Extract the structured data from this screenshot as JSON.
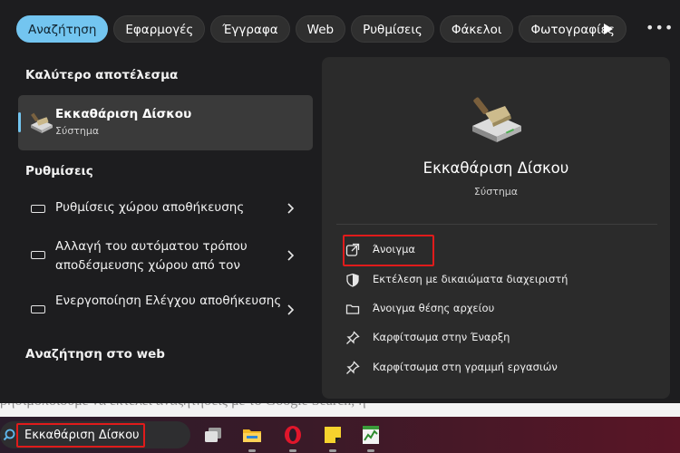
{
  "tabs": [
    {
      "label": "Αναζήτηση",
      "active": true
    },
    {
      "label": "Εφαρμογές",
      "active": false
    },
    {
      "label": "Έγγραφα",
      "active": false
    },
    {
      "label": "Web",
      "active": false
    },
    {
      "label": "Ρυθμίσεις",
      "active": false
    },
    {
      "label": "Φάκελοι",
      "active": false
    },
    {
      "label": "Φωτογραφίες",
      "active": false
    }
  ],
  "tab_more_icon": "more-icon",
  "left": {
    "best_match_title": "Καλύτερο αποτέλεσμα",
    "best_match": {
      "name": "Εκκαθάριση Δίσκου",
      "category": "Σύστημα",
      "icon": "disk-cleanup-icon"
    },
    "settings_title": "Ρυθμίσεις",
    "settings": [
      {
        "label": "Ρυθμίσεις χώρου αποθήκευσης",
        "icon": "storage-icon"
      },
      {
        "label": "Αλλαγή του αυτόματου τρόπου αποδέσμευσης χώρου από τον",
        "icon": "storage-icon"
      },
      {
        "label": "Ενεργοποίηση Ελέγχου αποθήκευσης",
        "icon": "storage-icon"
      }
    ],
    "web_title": "Αναζήτηση στο web"
  },
  "detail": {
    "name": "Εκκαθάριση Δίσκου",
    "category": "Σύστημα",
    "actions": [
      {
        "label": "Άνοιγμα",
        "icon": "open-icon"
      },
      {
        "label": "Εκτέλεση με δικαιώματα διαχειριστή",
        "icon": "shield-icon"
      },
      {
        "label": "Άνοιγμα θέσης αρχείου",
        "icon": "folder-icon"
      },
      {
        "label": "Καρφίτσωμα στην Έναρξη",
        "icon": "pin-icon"
      },
      {
        "label": "Καρφίτσωμα στη γραμμή εργασιών",
        "icon": "pin-icon"
      }
    ]
  },
  "background_page_text": "ρησιμοποιούμε να εκτελεί αναζητήσεις με το Google Search, η",
  "taskbar": {
    "search_value": "Εκκαθάριση Δίσκου",
    "apps": [
      "task-view-icon",
      "file-explorer-icon",
      "opera-icon",
      "sticky-notes-icon",
      "task-manager-icon"
    ]
  },
  "colors": {
    "accent": "#73c5f0",
    "highlight": "#e01b1b",
    "panel": "#2b2b2b"
  }
}
